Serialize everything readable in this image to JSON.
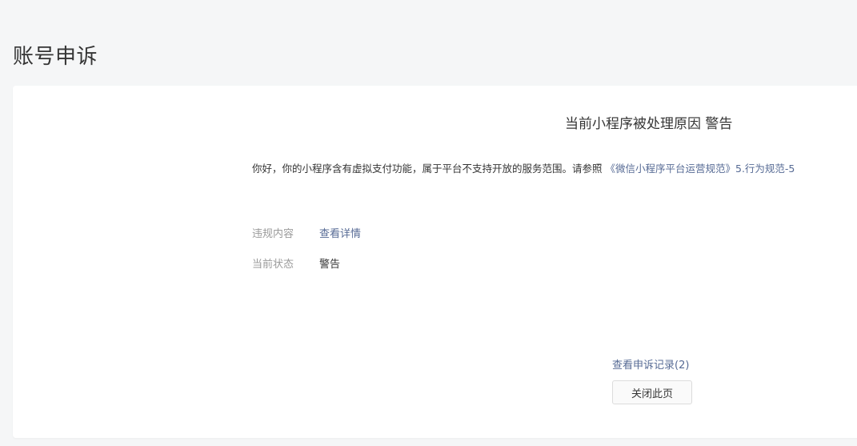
{
  "page": {
    "title": "账号申诉"
  },
  "reason": {
    "title": "当前小程序被处理原因 警告",
    "notice_text": "你好，你的小程序含有虚拟支付功能，属于平台不支持开放的服务范围。请参照 ",
    "notice_link": "《微信小程序平台运营规范》5.行为规范-5"
  },
  "details": {
    "violation_label": "违规内容",
    "violation_link": "查看详情",
    "status_label": "当前状态",
    "status_value": "警告"
  },
  "actions": {
    "records_link": "查看申诉记录(2)",
    "close_button": "关闭此页"
  },
  "colors": {
    "link": "#576b95",
    "label": "#9a9a9a",
    "text": "#353535",
    "background": "#f5f6f7"
  }
}
